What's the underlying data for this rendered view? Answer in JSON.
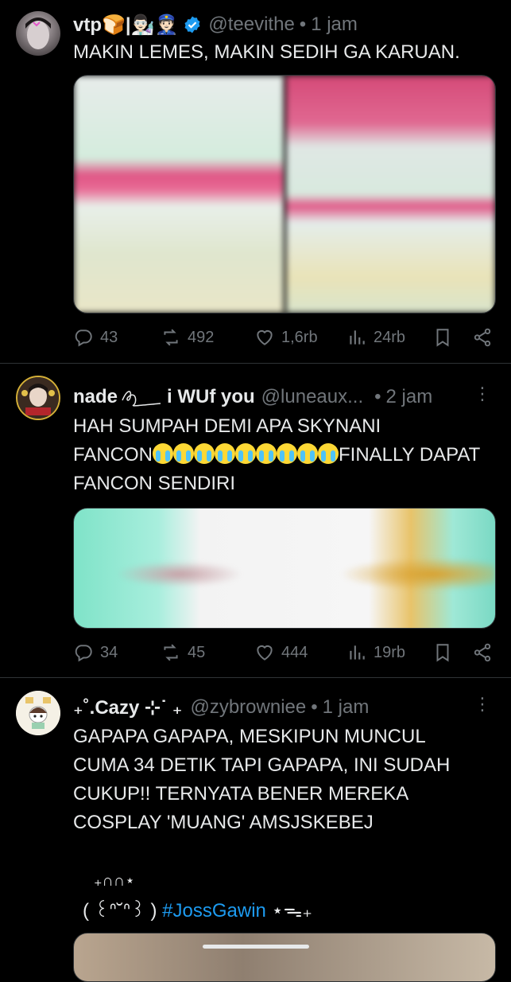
{
  "tweets": [
    {
      "name": "vtp🍞|👨🏻‍🔬👮🏻",
      "handle": "@teevithe",
      "dot": "•",
      "time": "1 jam",
      "text": "MAKIN LEMES, MAKIN SEDIH GA KARUAN.",
      "replies": "43",
      "reposts": "492",
      "likes": "1,6rb",
      "views": "24rb"
    },
    {
      "name": "nade ",
      "name_suffix": "i WUf you",
      "handle": "@luneaux...",
      "dot": "•",
      "time": "2 jam",
      "text_line1": "HAH SUMPAH DEMI APA SKYNANI",
      "text_line2_start": "FANCON",
      "text_line2_end": "FINALLY DAPAT",
      "text_line3": "FANCON SENDIRI",
      "replies": "34",
      "reposts": "45",
      "likes": "444",
      "views": "19rb"
    },
    {
      "name": "₊˚.Cazy ⊹˙ ₊",
      "handle": "@zybrowniee",
      "dot": "•",
      "time": "1 jam",
      "text": "GAPAPA GAPAPA, MESKIPUN MUNCUL CUMA 34 DETIK TAPI GAPAPA, INI SUDAH CUKUP!! TERNYATA BENER MEREKA COSPLAY 'MUANG' AMSJSKEBEJ",
      "kaomoji_top": "₊∩∩⋆",
      "kaomoji_bottom": "( ꒰ᐢ˘ᐢ꒱ )",
      "hashtag": "#JossGawin",
      "tail": "⋆ᯓ₊"
    }
  ],
  "more_label": "⋮",
  "colors": {
    "accent": "#1d9bf0",
    "muted": "#71767b",
    "verified": "#1d9bf0"
  }
}
